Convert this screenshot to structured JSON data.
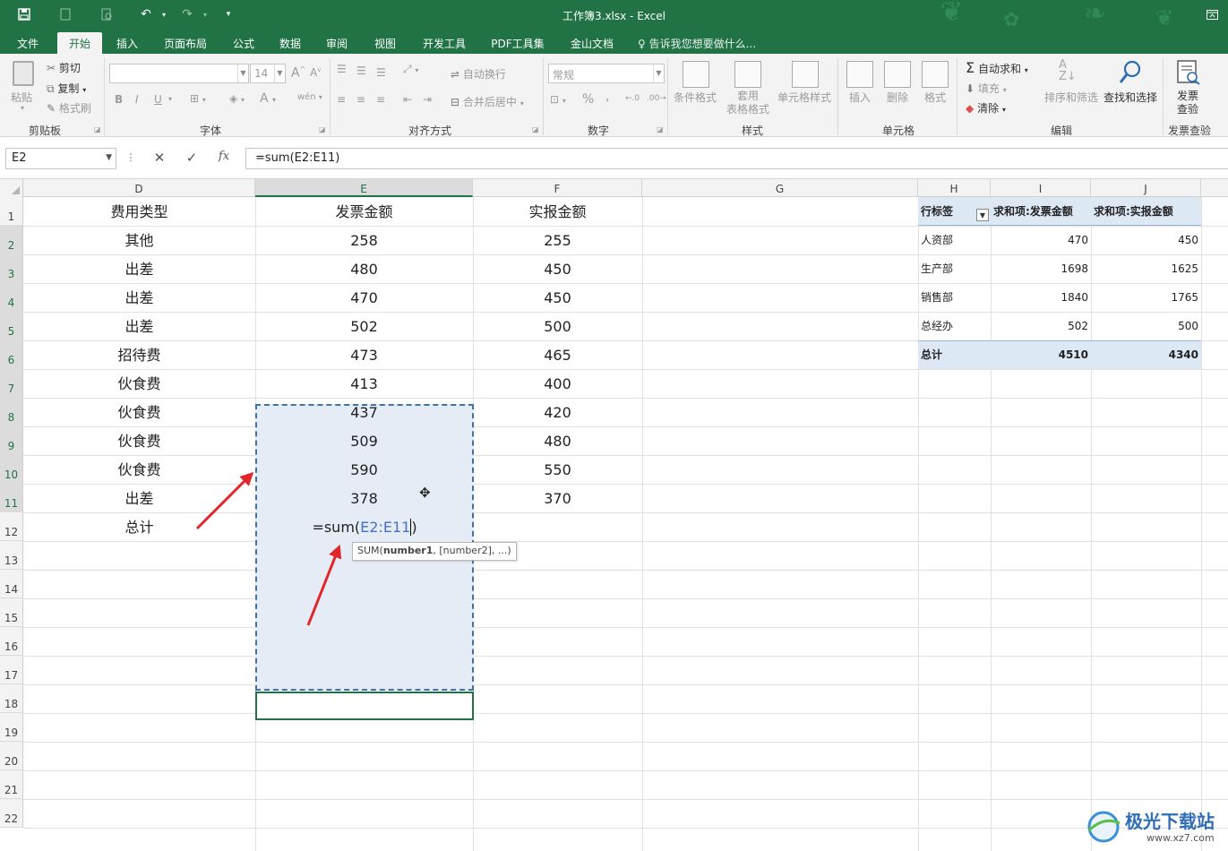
{
  "window": {
    "title": "工作簿3.xlsx - Excel"
  },
  "menu": {
    "tabs": [
      "文件",
      "开始",
      "插入",
      "页面布局",
      "公式",
      "数据",
      "审阅",
      "视图",
      "开发工具",
      "PDF工具集",
      "金山文档"
    ],
    "active_tab": "开始",
    "tell_me": "告诉我您想要做什么..."
  },
  "ribbon": {
    "clipboard": {
      "label": "剪贴板",
      "paste": "粘贴",
      "cut": "剪切",
      "copy": "复制",
      "format_painter": "格式刷"
    },
    "font": {
      "label": "字体",
      "font_name": "",
      "font_size": "14",
      "bold": "B",
      "italic": "I",
      "underline": "U"
    },
    "alignment": {
      "label": "对齐方式",
      "wrap": "自动换行",
      "merge": "合并后居中"
    },
    "number": {
      "label": "数字",
      "format": "常规",
      "percent": "%",
      "comma": ","
    },
    "styles": {
      "label": "样式",
      "conditional": "条件格式",
      "table": "套用\n表格格式",
      "cell_styles": "单元格样式"
    },
    "cells": {
      "label": "单元格",
      "insert": "插入",
      "delete": "删除",
      "format": "格式"
    },
    "editing": {
      "label": "编辑",
      "autosum": "自动求和",
      "fill": "填充",
      "clear": "清除",
      "sort": "排序和筛选",
      "find": "查找和选择"
    },
    "invoice": {
      "label": "发票查验",
      "button": "发票\n查验"
    }
  },
  "formula_bar": {
    "name_box": "E2",
    "formula": "=sum(E2:E11)",
    "fx": "fx"
  },
  "columns": [
    "D",
    "E",
    "F",
    "G",
    "H",
    "I",
    "J"
  ],
  "rows": [
    "1",
    "2",
    "3",
    "4",
    "5",
    "6",
    "7",
    "8",
    "9",
    "10",
    "11",
    "12",
    "13",
    "14",
    "15",
    "16",
    "17",
    "18",
    "19",
    "20",
    "21",
    "22"
  ],
  "table": {
    "headers": [
      "费用类型",
      "发票金额",
      "实报金额"
    ],
    "rows": [
      [
        "其他",
        "258",
        "255"
      ],
      [
        "出差",
        "480",
        "450"
      ],
      [
        "出差",
        "470",
        "450"
      ],
      [
        "出差",
        "502",
        "500"
      ],
      [
        "招待费",
        "473",
        "465"
      ],
      [
        "伙食费",
        "413",
        "400"
      ],
      [
        "伙食费",
        "437",
        "420"
      ],
      [
        "伙食费",
        "509",
        "480"
      ],
      [
        "伙食费",
        "590",
        "550"
      ],
      [
        "出差",
        "378",
        "370"
      ]
    ],
    "total_label": "总计",
    "editing_formula_prefix": "=sum(",
    "editing_formula_ref": "E2:E11",
    "editing_formula_suffix": ")"
  },
  "tooltip": {
    "fn": "SUM(",
    "arg1": "number1",
    "rest": ", [number2], ...)"
  },
  "pivot": {
    "headers": [
      "行标签",
      "求和项:发票金额",
      "求和项:实报金额"
    ],
    "rows": [
      [
        "人资部",
        "470",
        "450"
      ],
      [
        "生产部",
        "1698",
        "1625"
      ],
      [
        "销售部",
        "1840",
        "1765"
      ],
      [
        "总经办",
        "502",
        "500"
      ]
    ],
    "total": [
      "总计",
      "4510",
      "4340"
    ]
  },
  "watermark": {
    "text": "极光下载站",
    "url": "www.xz7.com"
  },
  "colors": {
    "excel_green": "#217346",
    "arrow_red": "#e0262b",
    "selection_fill": "#e6ecf6",
    "pivot_header": "#dde8f5"
  }
}
